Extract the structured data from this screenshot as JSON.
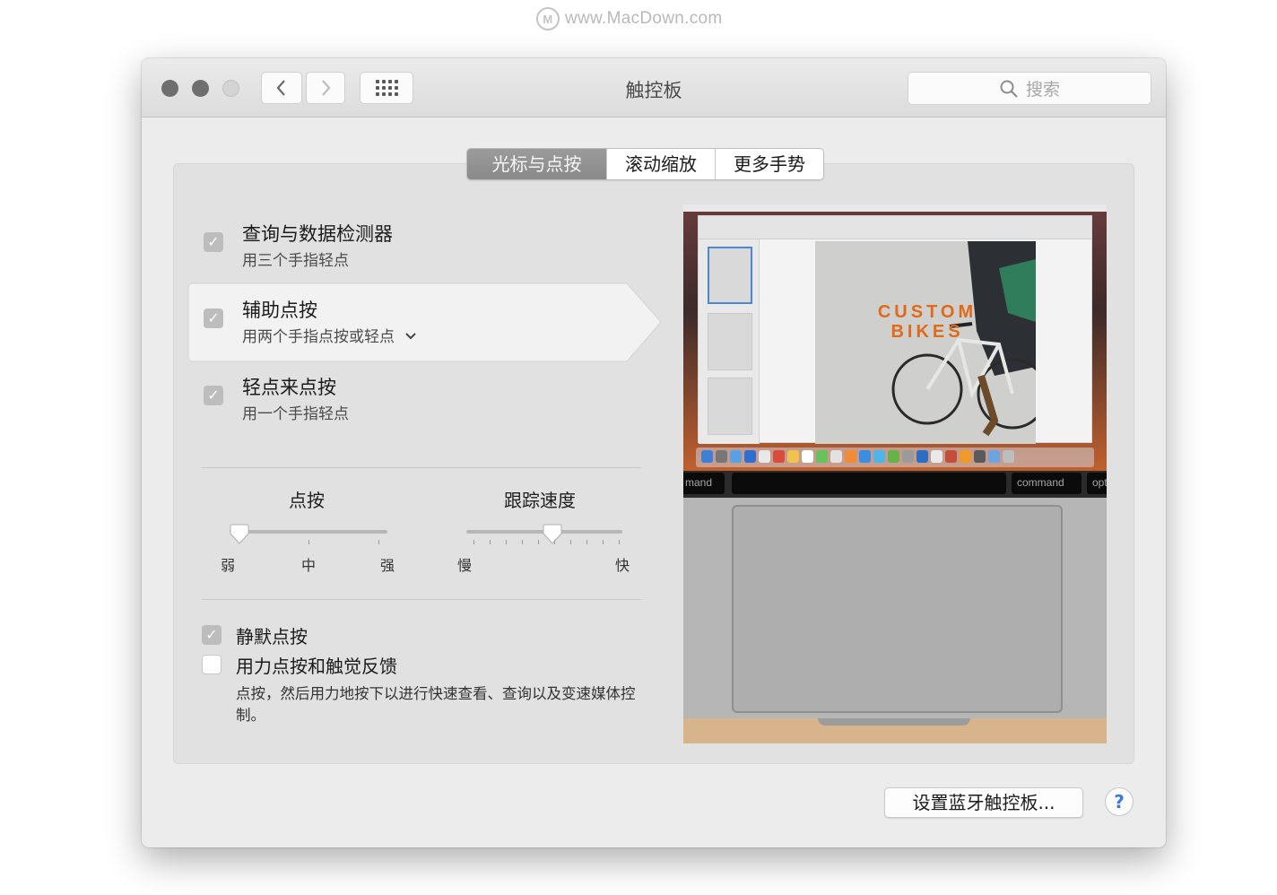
{
  "watermark": {
    "logo_letter": "M",
    "text": "www.MacDown.com"
  },
  "window": {
    "title": "触控板",
    "search_placeholder": "搜索"
  },
  "tabs": [
    {
      "label": "光标与点按",
      "active": true
    },
    {
      "label": "滚动缩放",
      "active": false
    },
    {
      "label": "更多手势",
      "active": false
    }
  ],
  "options": [
    {
      "title": "查询与数据检测器",
      "subtitle": "用三个手指轻点",
      "checked": true
    },
    {
      "title": "辅助点按",
      "subtitle": "用两个手指点按或轻点",
      "checked": true,
      "selected": true
    },
    {
      "title": "轻点来点按",
      "subtitle": "用一个手指轻点",
      "checked": true
    }
  ],
  "sliders": {
    "click": {
      "label": "点按",
      "min_label": "弱",
      "mid_label": "中",
      "max_label": "强",
      "value": 0
    },
    "tracking": {
      "label": "跟踪速度",
      "min_label": "慢",
      "max_label": "快",
      "value": 0.55
    }
  },
  "bottom_options": [
    {
      "label": "静默点按",
      "checked": true
    },
    {
      "label": "用力点按和触觉反馈",
      "checked": false
    }
  ],
  "force_click_description": "点按，然后用力地按下以进行快速查看、查询以及变速媒体控制。",
  "preview": {
    "image_caption_line1": "CUSTOM",
    "image_caption_line2": "BIKES",
    "key_left": "mand",
    "key_command": "command",
    "key_opt": "opt"
  },
  "bluetooth_button": "设置蓝牙触控板...",
  "help_label": "?",
  "colors": {
    "checkbox_checked": "#bdbdbd",
    "tab_active": "#8f8f8f",
    "accent_orange": "#e06a1c",
    "help_blue": "#3b78e7"
  }
}
